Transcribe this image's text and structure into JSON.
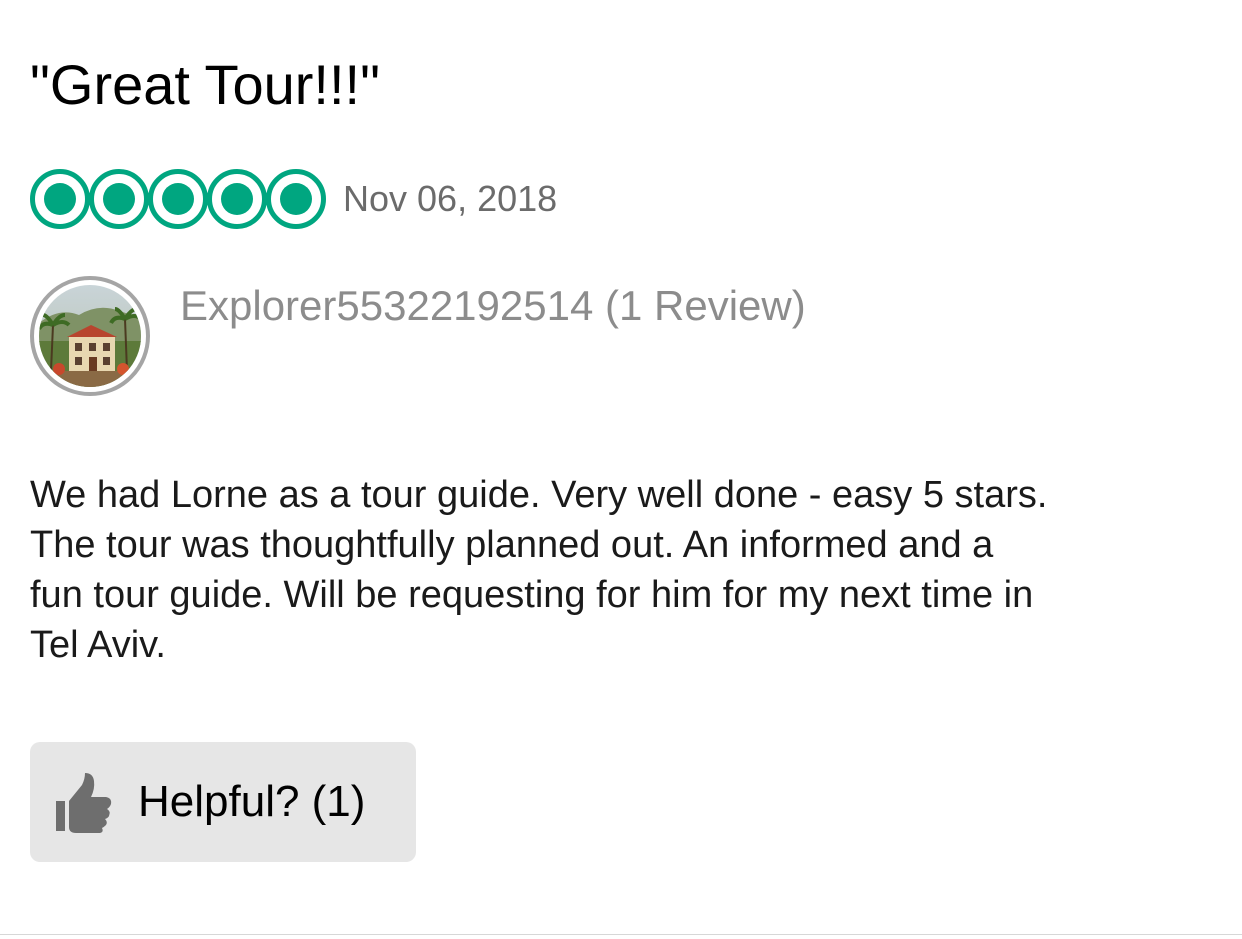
{
  "review": {
    "title": "\"Great Tour!!!\"",
    "rating": 5,
    "rating_max": 5,
    "rating_icon": "bubble-rating-icon",
    "date": "Nov 06, 2018",
    "reviewer": {
      "name": "Explorer55322192514 (1 Review)",
      "avatar_icon": "avatar-photo"
    },
    "body": "We had Lorne as a tour guide.  Very well done - easy 5 stars.\nThe tour was thoughtfully planned out. An informed and a\nfun tour guide. Will be requesting for him for my next time in\nTel Aviv.",
    "helpful": {
      "icon": "thumbs-up-icon",
      "label": "Helpful? (1)"
    }
  },
  "colors": {
    "rating_accent": "#00a680",
    "date_text": "#6b6b6b",
    "reviewer_text": "#8c8c8c",
    "button_background": "#e6e6e6",
    "thumb_icon": "#6e6e6e"
  }
}
